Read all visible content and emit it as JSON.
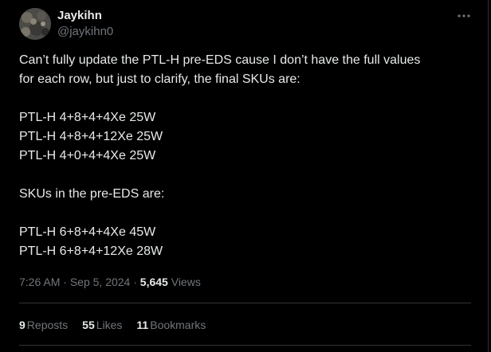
{
  "author": {
    "display_name": "Jaykihn",
    "handle": "@jaykihn0",
    "avatar_icon": "user-avatar"
  },
  "tweet": {
    "line1": "Can’t fully update the PTL-H pre-EDS cause I don’t have the full values",
    "line2": "for each row, but just to clarify, the final SKUs are:",
    "final_skus": [
      "PTL-H 4+8+4+4Xe 25W",
      "PTL-H 4+8+4+12Xe 25W",
      "PTL-H 4+0+4+4Xe 25W"
    ],
    "pre_eds_heading": "SKUs in the pre-EDS are:",
    "pre_eds_skus": [
      "PTL-H 6+8+4+4Xe 45W",
      "PTL-H 6+8+4+12Xe 28W"
    ]
  },
  "meta": {
    "time": "7:26 AM",
    "separator": " · ",
    "date": "Sep 5, 2024",
    "views_count": "5,645",
    "views_label": "Views"
  },
  "stats": {
    "reposts_count": "9",
    "reposts_label": "Reposts",
    "likes_count": "55",
    "likes_label": "Likes",
    "bookmarks_count": "11",
    "bookmarks_label": "Bookmarks"
  },
  "colors": {
    "background": "#000000",
    "text_primary": "#e7e9ea",
    "text_secondary": "#71767b",
    "divider": "#2f3336"
  }
}
